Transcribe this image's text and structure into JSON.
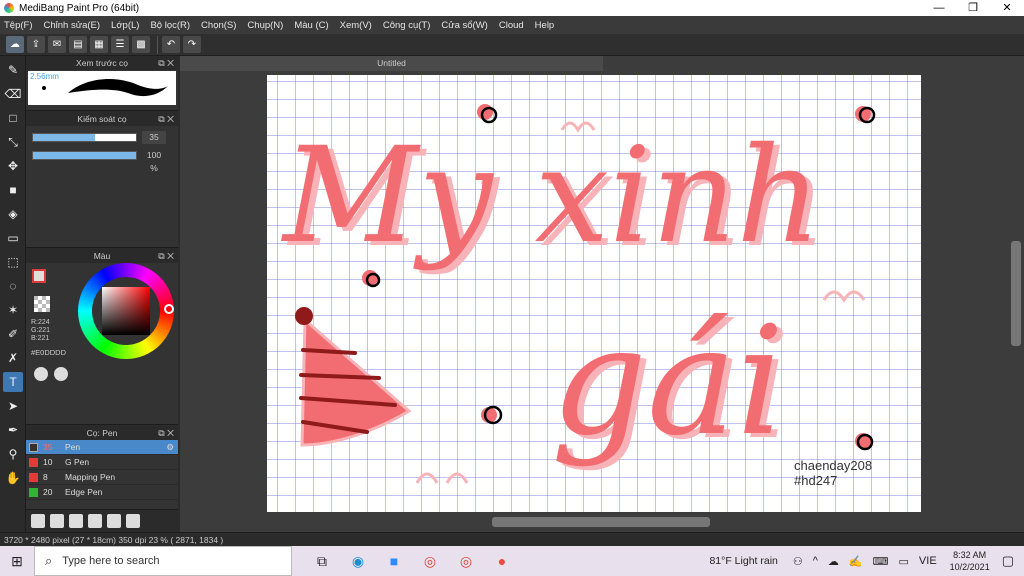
{
  "window": {
    "title": "MediBang Paint Pro (64bit)",
    "min": "—",
    "max": "❐",
    "close": "✕"
  },
  "menu": [
    "Tệp(F)",
    "Chỉnh sửa(E)",
    "Lớp(L)",
    "Bộ lọc(R)",
    "Chọn(S)",
    "Chụp(N)",
    "Màu (C)",
    "Xem(V)",
    "Công cụ(T)",
    "Cửa sổ(W)",
    "Cloud",
    "Help"
  ],
  "document": {
    "tab_title": "Untitled"
  },
  "panels": {
    "brush_preview": {
      "title": "Xem trước cọ",
      "size_label": "2.56mm"
    },
    "brush_control": {
      "title": "Kiểm soát cọ",
      "size_value": "35",
      "opacity_value": "100 %",
      "size_fraction": 0.6,
      "opacity_fraction": 1.0
    },
    "color": {
      "title": "Màu",
      "r": "R:224",
      "g": "G:221",
      "b": "B:221",
      "hex": "#E0DDDD"
    },
    "pens": {
      "title": "Cọ: Pen",
      "items": [
        {
          "num": "35",
          "name": "Pen",
          "color": "#333333",
          "selected": true
        },
        {
          "num": "10",
          "name": "G Pen",
          "color": "#e03c3c"
        },
        {
          "num": "8",
          "name": "Mapping Pen",
          "color": "#e03c3c"
        },
        {
          "num": "20",
          "name": "Edge Pen",
          "color": "#2fb52f"
        }
      ]
    }
  },
  "artwork": {
    "line1": "My xinh",
    "line2": "gái",
    "signature_name": "chaenday208",
    "signature_tag": "#hd247",
    "colors": {
      "main": "#f26d72",
      "shadow": "#f7b3b8",
      "hat_stripe": "#8e1a1a"
    }
  },
  "status": {
    "text": "3720 * 2480 pixel   (27 * 18cm)   350 dpi   23 %   ( 2871, 1834 )"
  },
  "taskbar": {
    "search_placeholder": "Type here to search",
    "weather": "81°F  Light rain",
    "lang": "VIE",
    "time": "8:32 AM",
    "date": "10/2/2021"
  }
}
